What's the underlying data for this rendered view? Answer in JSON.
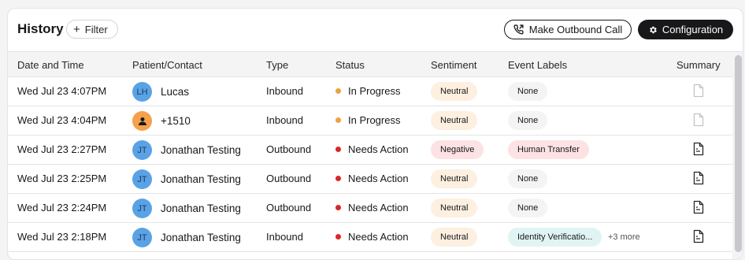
{
  "header": {
    "title": "History",
    "filter_label": "Filter",
    "outbound_label": "Make Outbound Call",
    "config_label": "Configuration"
  },
  "columns": [
    "Date and Time",
    "Patient/Contact",
    "Type",
    "Status",
    "Sentiment",
    "Event Labels",
    "Summary"
  ],
  "rows": [
    {
      "date": "Wed Jul 23 4:07PM",
      "avatar": "LH",
      "avatar_icon": "",
      "avatar_color": "#5aa2e6",
      "name": "Lucas",
      "type": "Inbound",
      "status": "In Progress",
      "status_color": "#f0a040",
      "sentiment": "Neutral",
      "sentiment_bg": "#fdf0e0",
      "label": "None",
      "label_bg": "#f4f4f5",
      "more": "",
      "summary_icon": "document-faded-icon"
    },
    {
      "date": "Wed Jul 23 4:04PM",
      "avatar": "",
      "avatar_icon": "person-icon",
      "avatar_color": "#f5a04a",
      "name": "+1510",
      "type": "Inbound",
      "status": "In Progress",
      "status_color": "#f0a040",
      "sentiment": "Neutral",
      "sentiment_bg": "#fdf0e0",
      "label": "None",
      "label_bg": "#f4f4f5",
      "more": "",
      "summary_icon": "document-faded-icon"
    },
    {
      "date": "Wed Jul 23 2:27PM",
      "avatar": "JT",
      "avatar_icon": "",
      "avatar_color": "#5aa2e6",
      "name": "Jonathan Testing",
      "type": "Outbound",
      "status": "Needs Action",
      "status_color": "#dc2626",
      "sentiment": "Negative",
      "sentiment_bg": "#fde2e4",
      "label": "Human Transfer",
      "label_bg": "#fde2e4",
      "more": "",
      "summary_icon": "document-icon"
    },
    {
      "date": "Wed Jul 23 2:25PM",
      "avatar": "JT",
      "avatar_icon": "",
      "avatar_color": "#5aa2e6",
      "name": "Jonathan Testing",
      "type": "Outbound",
      "status": "Needs Action",
      "status_color": "#dc2626",
      "sentiment": "Neutral",
      "sentiment_bg": "#fdf0e0",
      "label": "None",
      "label_bg": "#f4f4f5",
      "more": "",
      "summary_icon": "document-icon"
    },
    {
      "date": "Wed Jul 23 2:24PM",
      "avatar": "JT",
      "avatar_icon": "",
      "avatar_color": "#5aa2e6",
      "name": "Jonathan Testing",
      "type": "Outbound",
      "status": "Needs Action",
      "status_color": "#dc2626",
      "sentiment": "Neutral",
      "sentiment_bg": "#fdf0e0",
      "label": "None",
      "label_bg": "#f4f4f5",
      "more": "",
      "summary_icon": "document-icon"
    },
    {
      "date": "Wed Jul 23 2:18PM",
      "avatar": "JT",
      "avatar_icon": "",
      "avatar_color": "#5aa2e6",
      "name": "Jonathan Testing",
      "type": "Inbound",
      "status": "Needs Action",
      "status_color": "#dc2626",
      "sentiment": "Neutral",
      "sentiment_bg": "#fdf0e0",
      "label": "Identity Verificatio...",
      "label_bg": "#e0f5f3",
      "more": "+3 more",
      "summary_icon": "document-icon"
    }
  ]
}
